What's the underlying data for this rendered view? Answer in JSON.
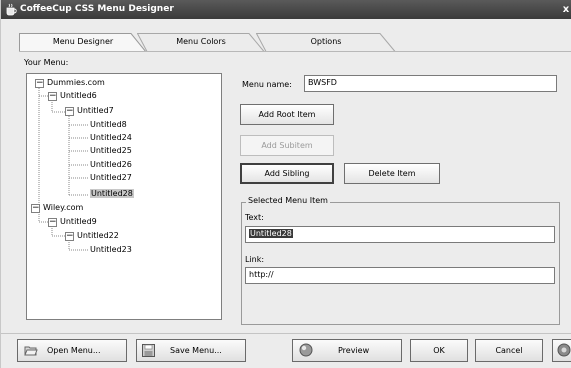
{
  "window": {
    "title": "CoffeeCup CSS Menu Designer",
    "close_glyph": "x"
  },
  "tabs": [
    {
      "label": "Menu Designer",
      "active": true
    },
    {
      "label": "Menu Colors",
      "active": false
    },
    {
      "label": "Options",
      "active": false
    }
  ],
  "tree": {
    "label": "Your Menu:",
    "nodes": [
      {
        "label": "Dummies.com",
        "expander": "−"
      },
      {
        "label": "Untitled6",
        "expander": "−"
      },
      {
        "label": "Untitled7",
        "expander": "−"
      },
      {
        "label": "Untitled8"
      },
      {
        "label": "Untitled24"
      },
      {
        "label": "Untitled25"
      },
      {
        "label": "Untitled26"
      },
      {
        "label": "Untitled27"
      },
      {
        "label": "Untitled28",
        "selected": true
      },
      {
        "label": "Wiley.com",
        "expander": "−"
      },
      {
        "label": "Untitled9",
        "expander": "−"
      },
      {
        "label": "Untitled22",
        "expander": "−"
      },
      {
        "label": "Untitled23"
      }
    ]
  },
  "form": {
    "menu_name_label": "Menu name:",
    "menu_name_value": "BWSFD",
    "add_root_label": "Add Root Item",
    "add_subitem_label": "Add Subitem",
    "add_sibling_label": "Add Sibling",
    "delete_item_label": "Delete Item",
    "group_title": "Selected Menu Item",
    "text_label": "Text:",
    "text_value": "Untitled28",
    "link_label": "Link:",
    "link_value": "http://"
  },
  "bottom": {
    "open_label": "Open Menu...",
    "save_label": "Save Menu...",
    "preview_label": "Preview",
    "ok_label": "OK",
    "cancel_label": "Cancel"
  },
  "icons": {
    "app": "coffee-cup-icon",
    "open": "folder-open-icon",
    "save": "floppy-disk-icon",
    "preview": "globe-icon",
    "help": "help-icon"
  },
  "colors": {
    "titlebar": "#3a3a3a",
    "selection": "#3a3a3a",
    "window_bg": "#ececec"
  }
}
